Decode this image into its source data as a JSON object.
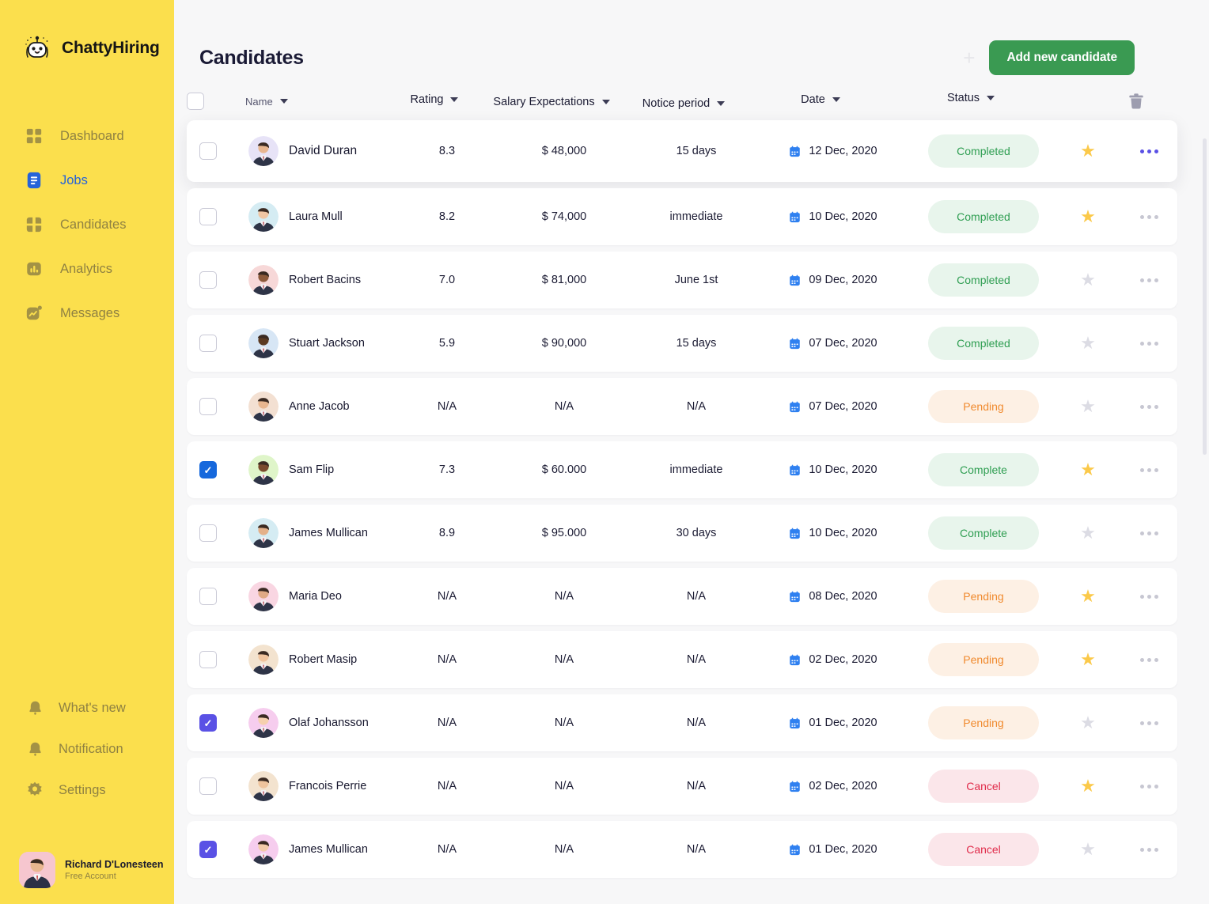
{
  "brand": {
    "name": "ChattyHiring",
    "logo_icon": "robot-mascot-icon"
  },
  "sidebar": {
    "nav": [
      {
        "label": "Dashboard",
        "icon": "grid-icon",
        "active": false
      },
      {
        "label": "Jobs",
        "icon": "document-list-icon",
        "active": true
      },
      {
        "label": "Candidates",
        "icon": "candidates-icon",
        "active": false
      },
      {
        "label": "Analytics",
        "icon": "bar-chart-icon",
        "active": false
      },
      {
        "label": "Messages",
        "icon": "message-chart-icon",
        "active": false
      }
    ],
    "nav_bottom": [
      {
        "label": "What's new",
        "icon": "bell-icon"
      },
      {
        "label": "Notification",
        "icon": "bell-icon"
      },
      {
        "label": "Settings",
        "icon": "gear-icon"
      }
    ],
    "profile": {
      "name": "Richard D'Lonesteen",
      "plan": "Free Account",
      "avatar_icon": "user-avatar"
    }
  },
  "header": {
    "title": "Candidates",
    "plus_icon": "plus-icon",
    "add_button": "Add new candidate",
    "add_button_color": "#3a9a52"
  },
  "table": {
    "columns": [
      {
        "key": "select",
        "label": ""
      },
      {
        "key": "name",
        "label": "Name",
        "sortable": true
      },
      {
        "key": "rating",
        "label": "Rating",
        "sortable": true
      },
      {
        "key": "salary",
        "label": "Salary Expectations",
        "sortable": true
      },
      {
        "key": "notice",
        "label": "Notice period",
        "sortable": true
      },
      {
        "key": "date",
        "label": "Date",
        "sortable": true
      },
      {
        "key": "status",
        "label": "Status",
        "sortable": true
      },
      {
        "key": "star",
        "label": ""
      },
      {
        "key": "menu",
        "label": ""
      }
    ],
    "delete_icon": "trash-icon",
    "header_checkbox_checked": false,
    "rows": [
      {
        "name": "David Duran",
        "rating": "8.3",
        "salary": "$ 48,000",
        "notice": "15 days",
        "date": "12 Dec, 2020",
        "status": "Completed",
        "status_kind": "completed",
        "checked": false,
        "check_color": "",
        "starred": true,
        "menu_active": true,
        "elevated": true,
        "avatar_bg": "#e7e3f7"
      },
      {
        "name": "Laura Mull",
        "rating": "8.2",
        "salary": "$ 74,000",
        "notice": "immediate",
        "date": "10 Dec, 2020",
        "status": "Completed",
        "status_kind": "completed",
        "checked": false,
        "check_color": "",
        "starred": true,
        "menu_active": false,
        "elevated": false,
        "avatar_bg": "#d5ecf3"
      },
      {
        "name": "Robert Bacins",
        "rating": "7.0",
        "salary": "$ 81,000",
        "notice": "June 1st",
        "date": "09 Dec, 2020",
        "status": "Completed",
        "status_kind": "completed",
        "checked": false,
        "check_color": "",
        "starred": false,
        "menu_active": false,
        "elevated": false,
        "avatar_bg": "#f7d8d8"
      },
      {
        "name": "Stuart Jackson",
        "rating": "5.9",
        "salary": "$ 90,000",
        "notice": "15 days",
        "date": "07 Dec, 2020",
        "status": "Completed",
        "status_kind": "completed",
        "checked": false,
        "check_color": "",
        "starred": false,
        "menu_active": false,
        "elevated": false,
        "avatar_bg": "#d7e6f5"
      },
      {
        "name": "Anne Jacob",
        "rating": "N/A",
        "salary": "N/A",
        "notice": "N/A",
        "date": "07 Dec, 2020",
        "status": "Pending",
        "status_kind": "pending",
        "checked": false,
        "check_color": "",
        "starred": false,
        "menu_active": false,
        "elevated": false,
        "avatar_bg": "#f3e0d2"
      },
      {
        "name": "Sam Flip",
        "rating": "7.3",
        "salary": "$ 60.000",
        "notice": "immediate",
        "date": "10 Dec, 2020",
        "status": "Complete",
        "status_kind": "completed",
        "checked": true,
        "check_color": "blue",
        "starred": true,
        "menu_active": false,
        "elevated": false,
        "avatar_bg": "#dff5c9"
      },
      {
        "name": "James Mullican",
        "rating": "8.9",
        "salary": "$ 95.000",
        "notice": "30 days",
        "date": "10 Dec, 2020",
        "status": "Complete",
        "status_kind": "completed",
        "checked": false,
        "check_color": "",
        "starred": false,
        "menu_active": false,
        "elevated": false,
        "avatar_bg": "#d5ecf3"
      },
      {
        "name": "Maria Deo",
        "rating": "N/A",
        "salary": "N/A",
        "notice": "N/A",
        "date": "08 Dec, 2020",
        "status": "Pending",
        "status_kind": "pending",
        "checked": false,
        "check_color": "",
        "starred": true,
        "menu_active": false,
        "elevated": false,
        "avatar_bg": "#f9d6e2"
      },
      {
        "name": "Robert Masip",
        "rating": "N/A",
        "salary": "N/A",
        "notice": "N/A",
        "date": "02 Dec, 2020",
        "status": "Pending",
        "status_kind": "pending",
        "checked": false,
        "check_color": "",
        "starred": true,
        "menu_active": false,
        "elevated": false,
        "avatar_bg": "#f3e3cf"
      },
      {
        "name": "Olaf Johansson",
        "rating": "N/A",
        "salary": "N/A",
        "notice": "N/A",
        "date": "01 Dec, 2020",
        "status": "Pending",
        "status_kind": "pending",
        "checked": true,
        "check_color": "indigo",
        "starred": false,
        "menu_active": false,
        "elevated": false,
        "avatar_bg": "#f6cdee"
      },
      {
        "name": "Francois Perrie",
        "rating": "N/A",
        "salary": "N/A",
        "notice": "N/A",
        "date": "02 Dec, 2020",
        "status": "Cancel",
        "status_kind": "cancel",
        "checked": false,
        "check_color": "",
        "starred": true,
        "menu_active": false,
        "elevated": false,
        "avatar_bg": "#f3e3cf"
      },
      {
        "name": "James Mullican",
        "rating": "N/A",
        "salary": "N/A",
        "notice": "N/A",
        "date": "01 Dec, 2020",
        "status": "Cancel",
        "status_kind": "cancel",
        "checked": true,
        "check_color": "indigo",
        "starred": false,
        "menu_active": false,
        "elevated": false,
        "avatar_bg": "#f6cdee"
      }
    ]
  },
  "colors": {
    "sidebar_bg": "#fbdf4d",
    "accent_blue": "#2563d9",
    "completed_text": "#2f9e52",
    "pending_text": "#f08a2e",
    "cancel_text": "#e02b4a",
    "star_on": "#fbc94a",
    "page_bg": "#f7f7f8"
  }
}
